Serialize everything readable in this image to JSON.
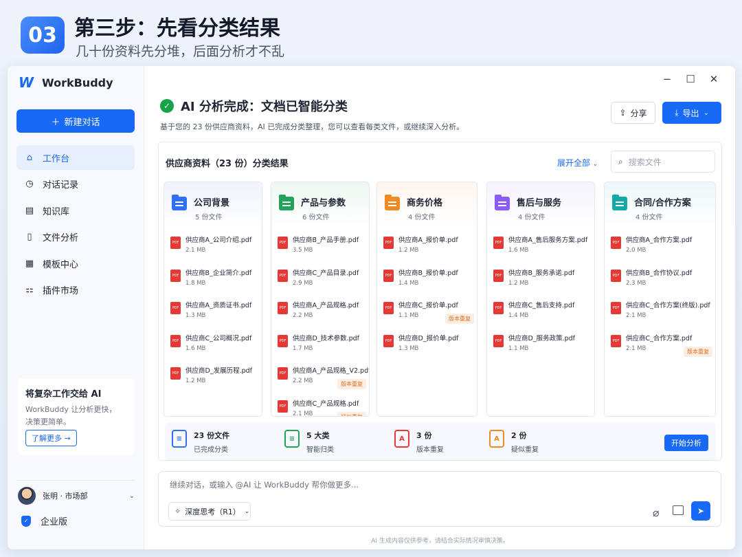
{
  "hero": {
    "badge": "03",
    "title": "第三步：先看分类结果",
    "subtitle": "几十份资料先分堆，后面分析才不乱"
  },
  "app": {
    "name": "WorkBuddy",
    "logo_mark": "W"
  },
  "sidebar": {
    "new_chat": "新建对话",
    "items": [
      {
        "label": "工作台",
        "icon": "home-icon"
      },
      {
        "label": "对话记录",
        "icon": "clock-icon"
      },
      {
        "label": "知识库",
        "icon": "book-icon"
      },
      {
        "label": "文件分析",
        "icon": "file-icon"
      },
      {
        "label": "模板中心",
        "icon": "grid-icon"
      },
      {
        "label": "插件市场",
        "icon": "plugin-icon"
      }
    ],
    "promo": {
      "title": "将复杂工作交给 AI",
      "desc": "WorkBuddy 让分析更快，决策更简单。",
      "button": "了解更多 →"
    },
    "user": "张明 · 市场部",
    "edition": "企业版"
  },
  "main": {
    "title": "AI 分析完成：文档已智能分类",
    "subtitle": "基于您的 23 份供应商资料，AI 已完成分类整理，您可以查看每类文件，或继续深入分析。",
    "share": "分享",
    "export": "导出"
  },
  "panel": {
    "title": "供应商资料（23 份）分类结果",
    "expand": "展开全部",
    "search_placeholder": "搜索文件",
    "columns": [
      {
        "name": "公司背景",
        "count": "5 份文件",
        "color": "#2f6ff5",
        "files": [
          {
            "name": "供应商A_公司介绍.pdf",
            "size": "2.1 MB",
            "tag": ""
          },
          {
            "name": "供应商B_企业简介.pdf",
            "size": "1.8 MB",
            "tag": ""
          },
          {
            "name": "供应商A_资质证书.pdf",
            "size": "1.3 MB",
            "tag": ""
          },
          {
            "name": "供应商C_公司概况.pdf",
            "size": "1.6 MB",
            "tag": ""
          },
          {
            "name": "供应商D_发展历程.pdf",
            "size": "1.2 MB",
            "tag": ""
          }
        ]
      },
      {
        "name": "产品与参数",
        "count": "6 份文件",
        "color": "#22a35a",
        "files": [
          {
            "name": "供应商B_产品手册.pdf",
            "size": "3.5 MB",
            "tag": ""
          },
          {
            "name": "供应商C_产品目录.pdf",
            "size": "2.9 MB",
            "tag": ""
          },
          {
            "name": "供应商A_产品规格.pdf",
            "size": "2.2 MB",
            "tag": ""
          },
          {
            "name": "供应商D_技术参数.pdf",
            "size": "1.7 MB",
            "tag": ""
          },
          {
            "name": "供应商A_产品规格_V2.pdf",
            "size": "2.2 MB",
            "tag": "版本重复"
          },
          {
            "name": "供应商C_产品规格.pdf",
            "size": "2.1 MB",
            "tag": "疑似重复"
          }
        ]
      },
      {
        "name": "商务价格",
        "count": "4 份文件",
        "color": "#f08a24",
        "files": [
          {
            "name": "供应商A_报价单.pdf",
            "size": "1.2 MB",
            "tag": ""
          },
          {
            "name": "供应商B_报价单.pdf",
            "size": "1.4 MB",
            "tag": ""
          },
          {
            "name": "供应商C_报价单.pdf",
            "size": "1.1 MB",
            "tag": "版本重复"
          },
          {
            "name": "供应商D_报价单.pdf",
            "size": "1.3 MB",
            "tag": ""
          }
        ]
      },
      {
        "name": "售后与服务",
        "count": "4 份文件",
        "color": "#8b5cf6",
        "files": [
          {
            "name": "供应商A_售后服务方案.pdf",
            "size": "1.6 MB",
            "tag": ""
          },
          {
            "name": "供应商B_服务承诺.pdf",
            "size": "1.2 MB",
            "tag": ""
          },
          {
            "name": "供应商C_售后支持.pdf",
            "size": "1.4 MB",
            "tag": ""
          },
          {
            "name": "供应商D_服务政策.pdf",
            "size": "1.1 MB",
            "tag": ""
          }
        ]
      },
      {
        "name": "合同/合作方案",
        "count": "4 份文件",
        "color": "#14a8a8",
        "files": [
          {
            "name": "供应商A_合作方案.pdf",
            "size": "2.0 MB",
            "tag": ""
          },
          {
            "name": "供应商B_合作协议.pdf",
            "size": "2.3 MB",
            "tag": ""
          },
          {
            "name": "供应商C_合作方案(终版).pdf",
            "size": "2.1 MB",
            "tag": ""
          },
          {
            "name": "供应商C_合作方案.pdf",
            "size": "2.1 MB",
            "tag": "版本重复"
          }
        ]
      }
    ],
    "summary": [
      {
        "value": "23 份文件",
        "label": "已完成分类",
        "color": "#2f6ff5",
        "glyph": "≡"
      },
      {
        "value": "5 大类",
        "label": "智能归类",
        "color": "#22a35a",
        "glyph": "≡"
      },
      {
        "value": "3 份",
        "label": "版本重复",
        "color": "#e53935",
        "glyph": "A"
      },
      {
        "value": "2 份",
        "label": "疑似重复",
        "color": "#f08a24",
        "glyph": "A"
      }
    ],
    "start": "开始分析"
  },
  "composer": {
    "placeholder": "继续对话，或输入 @AI 让 WorkBuddy 帮你做更多...",
    "mode": "深度思考（R1）"
  },
  "disclaimer": "AI 生成内容仅供参考，请结合实际情况审慎决策。",
  "pdf_label": "PDF"
}
